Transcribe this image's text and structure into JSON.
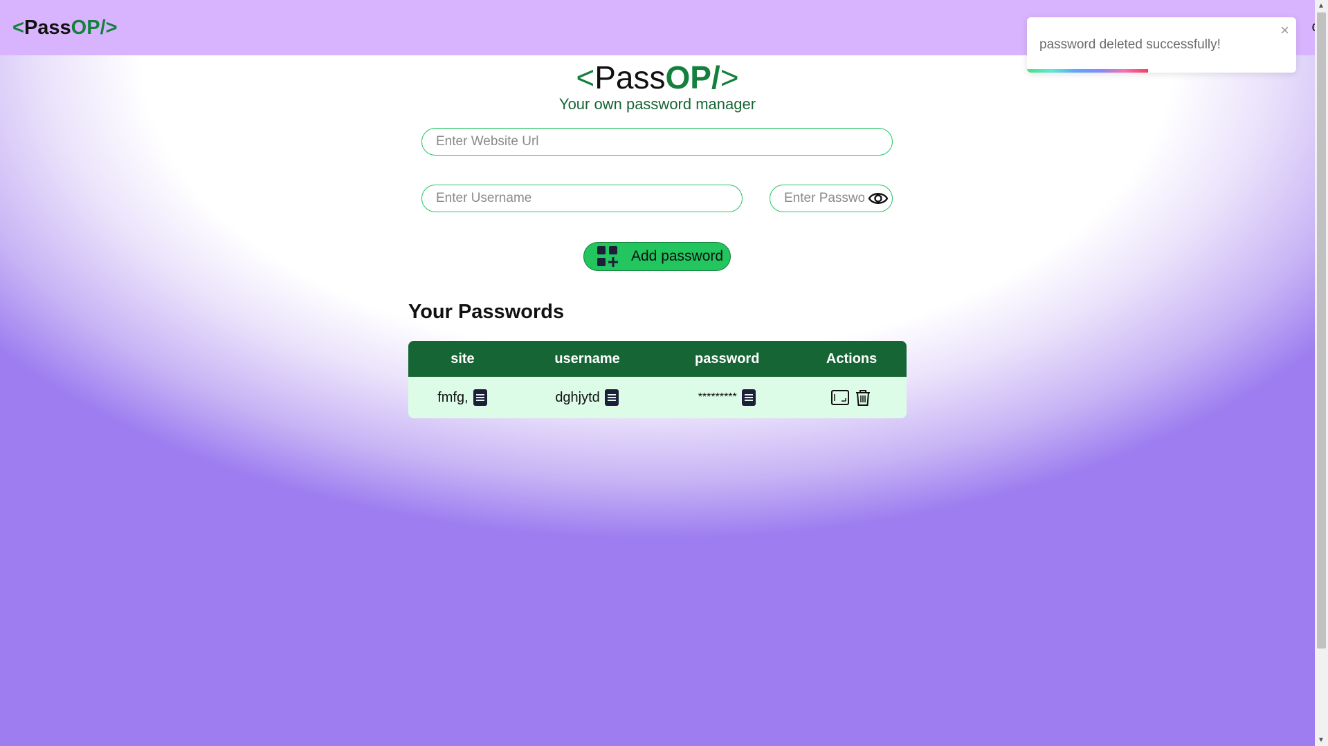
{
  "navbar": {
    "logo_prefix": "<",
    "logo_pass": "Pass",
    "logo_op": "OP/",
    "logo_suffix": ">",
    "partial_link": "ct"
  },
  "hero": {
    "logo_prefix": "<",
    "logo_pass": "Pass",
    "logo_op": "OP/",
    "logo_suffix": ">",
    "tagline": "Your own password manager"
  },
  "form": {
    "site_placeholder": "Enter Website Url",
    "username_placeholder": "Enter Username",
    "password_placeholder": "Enter Password",
    "add_button_label": "Add password"
  },
  "passwords": {
    "heading": "Your Passwords",
    "columns": [
      "site",
      "username",
      "password",
      "Actions"
    ],
    "rows": [
      {
        "site": "fmfg,",
        "username": "dghjytd",
        "password": "*********"
      }
    ]
  },
  "toast": {
    "message": "password deleted successfully!",
    "close": "×",
    "progress": 0.45
  },
  "icons": {
    "copy": "copy-icon",
    "edit": "edit-icon",
    "delete": "trash-icon",
    "eye": "eye-icon",
    "add": "add-grid-icon"
  },
  "colors": {
    "navbar": "#d8b4fe",
    "accent_green": "#22c55e",
    "table_header": "#166534",
    "table_row": "#dcfce7",
    "logo_green": "#15803d"
  }
}
